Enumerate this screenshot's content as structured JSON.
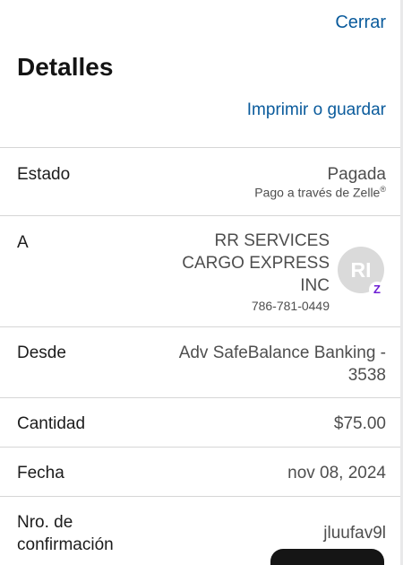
{
  "header": {
    "close_label": "Cerrar",
    "title": "Detalles",
    "print_label": "Imprimir o guardar"
  },
  "details": {
    "status": {
      "label": "Estado",
      "value": "Pagada",
      "method": "Pago a través de Zelle",
      "method_mark": "®"
    },
    "to": {
      "label": "A",
      "name_lines": [
        "RR SERVICES",
        "CARGO EXPRESS",
        "INC"
      ],
      "phone": "786-781-0449",
      "avatar_initials": "RI",
      "badge_glyph": "Z",
      "badge_color": "#6d1ed4"
    },
    "from": {
      "label": "Desde",
      "value_lines": [
        "Adv SafeBalance Banking -",
        "3538"
      ]
    },
    "amount": {
      "label": "Cantidad",
      "value": "$75.00"
    },
    "date": {
      "label": "Fecha",
      "value": "nov 08, 2024"
    },
    "confirmation": {
      "label_lines": [
        "Nro. de",
        "confirmación"
      ],
      "value": "jluufav9l"
    }
  },
  "colors": {
    "link": "#0a5b9c",
    "divider": "#d6d6d6",
    "value_text": "#4e4e4e",
    "avatar_bg": "#dadada"
  }
}
